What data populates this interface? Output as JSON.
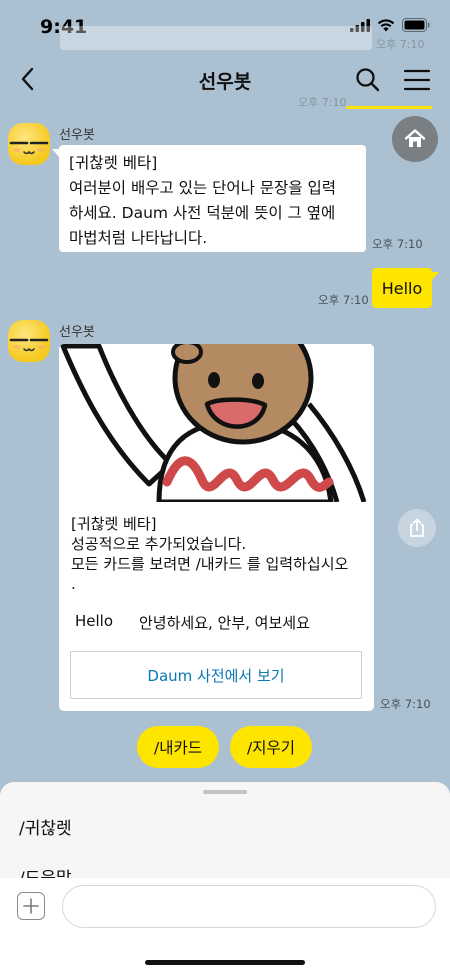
{
  "status": {
    "time": "9:41"
  },
  "background": {
    "times": [
      "오후 7:10",
      "오후 7:10"
    ]
  },
  "nav": {
    "title": "선우봇"
  },
  "messages": [
    {
      "sender": "선우봇",
      "lines": [
        "[귀찮렛 베타]",
        "여러분이 배우고 있는 단어나 문장을 입력",
        "하세요. Daum 사전 덕분에 뜻이 그 옆에",
        "마법처럼 나타납니다."
      ],
      "time": "오후 7:10"
    },
    {
      "text": "Hello",
      "time": "오후 7:10"
    },
    {
      "sender": "선우봇",
      "card": {
        "lines": [
          "[귀찮렛 베타]",
          "성공적으로 추가되었습니다.",
          "모든 카드를 보려면 /내카드 를 입력하십시오",
          "."
        ],
        "word": "Hello",
        "meaning": "안녕하세요, 안부, 여보세요",
        "button": "Daum 사전에서 보기"
      },
      "time": "오후 7:10"
    }
  ],
  "quick_replies": [
    "/내카드",
    "/지우기"
  ],
  "sheet": {
    "items": [
      "/귀찮렛",
      "/도움말"
    ]
  },
  "input": {
    "value": "",
    "placeholder": ""
  },
  "colors": {
    "background": "#abc1d1",
    "accent": "#fee500",
    "link": "#0b77b5"
  },
  "icons": {
    "back": "chevron-left-icon",
    "search": "search-icon",
    "menu": "hamburger-menu-icon",
    "home": "home-icon",
    "share": "share-icon",
    "plus": "plus-icon"
  }
}
